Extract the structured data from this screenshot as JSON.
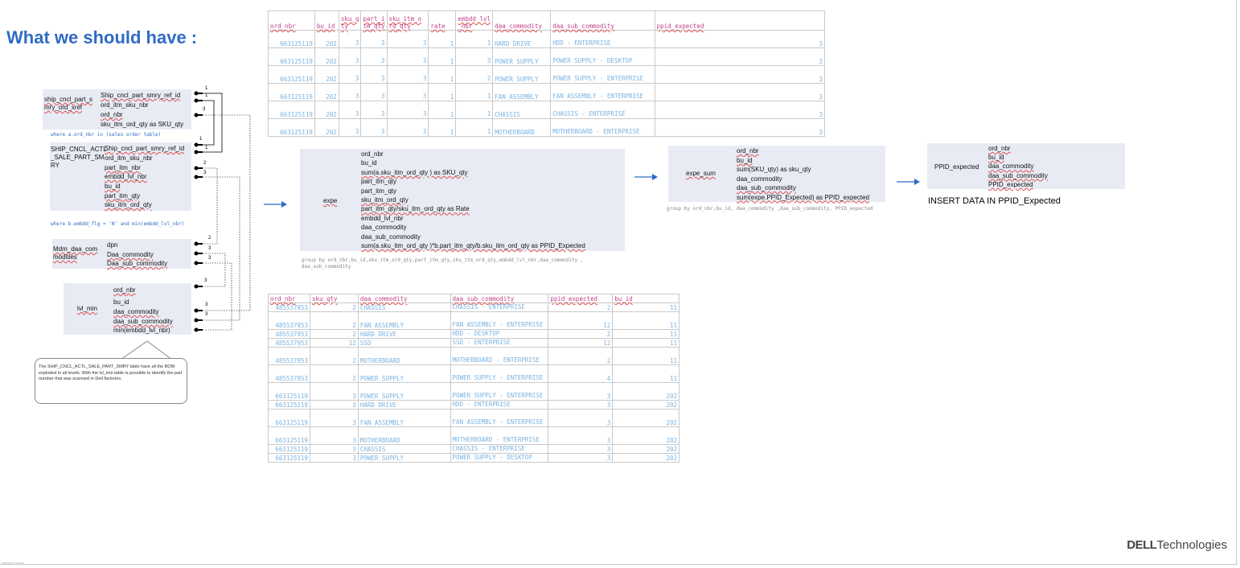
{
  "title": "What we should have :",
  "top_table": {
    "headers": [
      "ord_nbr",
      "bu_id",
      "sku_q ty",
      "part_i tm_qty",
      "sku_itm_o rd_qty",
      "rate",
      "embdd_lvl _nbr",
      "daa_commodity",
      "daa_sub_commodity",
      "ppid_expected"
    ],
    "rows": [
      [
        "663125119",
        "202",
        "3",
        "3",
        "3",
        "1",
        "1",
        "HARD DRIVE",
        "HDD - ENTERPRISE",
        "3"
      ],
      [
        "663125119",
        "202",
        "3",
        "3",
        "3",
        "1",
        "3",
        "POWER SUPPLY",
        "POWER SUPPLY - DESKTOP",
        "3"
      ],
      [
        "663125119",
        "202",
        "3",
        "3",
        "3",
        "1",
        "2",
        "POWER SUPPLY",
        "POWER SUPPLY - ENTERPRISE",
        "3"
      ],
      [
        "663125119",
        "202",
        "3",
        "3",
        "3",
        "1",
        "1",
        "FAN ASSEMBLY",
        "FAN ASSEMBLY - ENTERPRISE",
        "3"
      ],
      [
        "663125119",
        "202",
        "3",
        "3",
        "3",
        "1",
        "1",
        "CHASSIS",
        "CHASSIS - ENTERPRISE",
        "3"
      ],
      [
        "663125119",
        "202",
        "3",
        "3",
        "3",
        "1",
        "1",
        "MOTHERBOARD",
        "MOTHERBOARD - ENTERPRISE",
        "3"
      ]
    ]
  },
  "bottom_table": {
    "headers": [
      "ord_nbr",
      "sku_qty",
      "daa_commodity",
      "daa_sub_commodity",
      "ppid_expected",
      "bu_id"
    ],
    "rows": [
      [
        "485537953",
        "2",
        "CHASSIS",
        "CHASSIS - ENTERPRISE",
        "2",
        "11"
      ],
      [
        "485537953",
        "2",
        "FAN ASSEMBLY",
        "FAN ASSEMBLY - ENTERPRISE",
        "12",
        "11"
      ],
      [
        "485537953",
        "2",
        "HARD DRIVE",
        "HDD - DESKTOP",
        "2",
        "11"
      ],
      [
        "485537953",
        "12",
        "SSD",
        "SSD - ENTERPRISE",
        "12",
        "11"
      ],
      [
        "485537953",
        "2",
        "MOTHERBOARD",
        "MOTHERBOARD - ENTERPRISE",
        "2",
        "11"
      ],
      [
        "485537953",
        "2",
        "POWER SUPPLY",
        "POWER SUPPLY - ENTERPRISE",
        "4",
        "11"
      ],
      [
        "663125119",
        "3",
        "POWER SUPPLY",
        "POWER SUPPLY - ENTERPRISE",
        "3",
        "202"
      ],
      [
        "663125119",
        "3",
        "HARD DRIVE",
        "HDD - ENTERPRISE",
        "3",
        "202"
      ],
      [
        "663125119",
        "3",
        "FAN ASSEMBLY",
        "FAN ASSEMBLY - ENTERPRISE",
        "3",
        "202"
      ],
      [
        "663125119",
        "3",
        "MOTHERBOARD",
        "MOTHERBOARD - ENTERPRISE",
        "3",
        "202"
      ],
      [
        "663125119",
        "3",
        "CHASSIS",
        "CHASSIS - ENTERPRISE",
        "3",
        "202"
      ],
      [
        "663125119",
        "3",
        "POWER SUPPLY",
        "POWER SUPPLY - DESKTOP",
        "3",
        "202"
      ]
    ]
  },
  "schema": {
    "ship_xref": {
      "name": "ship_cncl_part_s mry_ord_xref",
      "cols": [
        "Ship_cncl_part_smry_ref_id",
        "ord_itm_sku_nbr",
        "ord_nbr",
        "sku_itm_ord_qty as SKU_qty"
      ],
      "where": "where a.ord_nbr in (sales order table)"
    },
    "ship_actl": {
      "name": "SHIP_CNCL_ACTL _SALE_PART_SM RY",
      "cols": [
        "Ship_cncl_part_smry_ref_id",
        "ord_itm_sku_nbr",
        "part_itm_nbr",
        "embdd_lvl_nbr",
        "bu_id",
        "part_itm_qty",
        "sku_itm_ord_qty"
      ],
      "where": "where b.embdd_flg = 'N' and min(embdd_lvl_nbr)"
    },
    "mdm": {
      "name": "Mdm_daa_com modities",
      "cols": [
        "dpn",
        "Daa_commodity",
        "Daa_sub_commodity"
      ]
    },
    "lvl_min": {
      "name": "lvl_min",
      "cols": [
        "ord_nbr",
        "bu_id",
        "daa_commodity",
        "daa_sub_commodity",
        "min(embdd_lvl_nbr)"
      ]
    },
    "callout": "The SHIP_CNCL_ACTL_SALE_PART_SMRY table have all the BOM exploded in all levels. With the lvl_min table is possible to identify the part number that was scanned in Dell factories.",
    "key_numbers": [
      "1",
      "1",
      "3",
      "1",
      "1",
      "2",
      "3",
      "2",
      "3",
      "3",
      "3",
      "3",
      "3"
    ]
  },
  "expe": {
    "name": "expe",
    "cols": [
      "ord_nbr",
      "bu_id",
      "sum(a.sku_itm_ord_qty ) as SKU_qty",
      "part_itm_qty",
      "part_itm_qty",
      "sku_itm_ord_qty",
      "part_itm_qty/sku_itm_ord_qty as Rate",
      "embdd_lvl_nbr",
      "daa_commodity",
      "daa_sub_commodity",
      "sum(a.sku_itm_ord_qty )*b.part_itm_qty/b.sku_itm_ord_qty as PPID_Expected"
    ],
    "group": "group by ord_nbr,bu_id,sku_itm_ord_qty,part_itm_qty,sku_itm_ord_qty,embdd_lvl_nbr,daa_commodity , daa_sub_commodity"
  },
  "expe_sum": {
    "name": "expe_sum",
    "cols": [
      "ord_nbr",
      "bu_id",
      "sum(SKU_qty) as sku_qty",
      "daa_commodity",
      "daa_sub_commodity",
      "sum(expe.PPID_Expected) as PPID_expected"
    ],
    "group": "group by ord_nbr,bu_id, daa_commodity ,daa_sub_commodity, PPID_expected"
  },
  "ppid": {
    "name": "PPID_expected",
    "cols": [
      "ord_nbr",
      "bu_id",
      "daa_commodity",
      "daa_sub_commodity",
      "PPID_expected"
    ],
    "insert": "INSERT DATA IN PPID_Expected"
  },
  "logo": {
    "brand": "DELL",
    "suffix": "Technologies"
  },
  "colors": {
    "title": "#2f6bc4",
    "header": "#c0408a",
    "cell": "#7ab3e0",
    "arrow": "#2f6bc4",
    "box": "#e8ebf4"
  }
}
